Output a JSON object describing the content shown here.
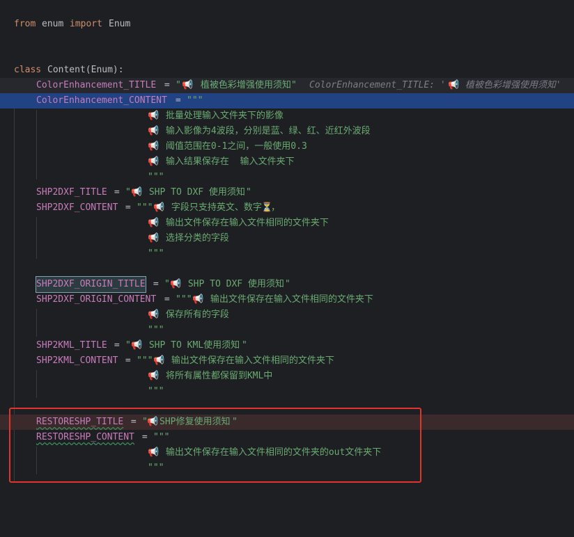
{
  "code": {
    "import_from": "from",
    "import_module": "enum",
    "import_kw": "import",
    "import_name": "Enum",
    "class_kw": "class",
    "class_decl": "Content(Enum):",
    "megaphone": "📢",
    "hourglass": "⏳",
    "quote_open": "\"",
    "quote_close": "\"",
    "triple": "\"\"\"",
    "assign": " = ",
    "l1_name": "ColorEnhancement_TITLE",
    "l1_text": " 植被色彩增强使用须知",
    "l1_hint_pre": "ColorEnhancement_TITLE: '",
    "l1_hint_text": " 植被色彩增强使用须知'",
    "l2_name": "ColorEnhancement_CONTENT",
    "c1": " 批量处理输入文件夹下的影像",
    "c2": " 输入影像为4波段，分别是蓝、绿、红、近红外波段",
    "c3": " 阈值范围在0-1之间，一般使用0.3",
    "c4": " 输入结果保存在  输入文件夹下",
    "l3_name": "SHP2DXF_TITLE",
    "l3_text": " SHP TO DXF 使用须知",
    "l4_name": "SHP2DXF_CONTENT",
    "l4_text": " 字段只支持英文、数字",
    "l4_tail": "，",
    "c5": " 输出文件保存在输入文件相同的文件夹下",
    "c6": " 选择分类的字段",
    "l5_name": "SHP2DXF_ORIGIN_TITLE",
    "l5_text": " SHP TO DXF 使用须知",
    "l6_name": "SHP2DXF_ORIGIN_CONTENT",
    "l6_text": " 输出文件保存在输入文件相同的文件夹下",
    "c7": " 保存所有的字段",
    "l7_name": "SHP2KML_TITLE",
    "l7_text": " SHP TO KML使用须知",
    "l8_name": "SHP2KML_CONTENT",
    "l8_text": " 输出文件保存在输入文件相同的文件夹下",
    "c8": " 将所有属性都保留到KML中",
    "l9_name": "RESTORESHP_TITLE",
    "l9_text": "SHP修复使用须知",
    "l10_name": "RESTORESHP_CONTENT",
    "c9": " 输出文件保存在输入文件相同的文件夹的out文件夹下"
  },
  "colors": {
    "background": "#1e1f22",
    "keyword": "#cf8e6d",
    "variable": "#c77dbb",
    "string": "#6aab73",
    "selection": "#214283",
    "annotation_box": "#e0342c"
  }
}
